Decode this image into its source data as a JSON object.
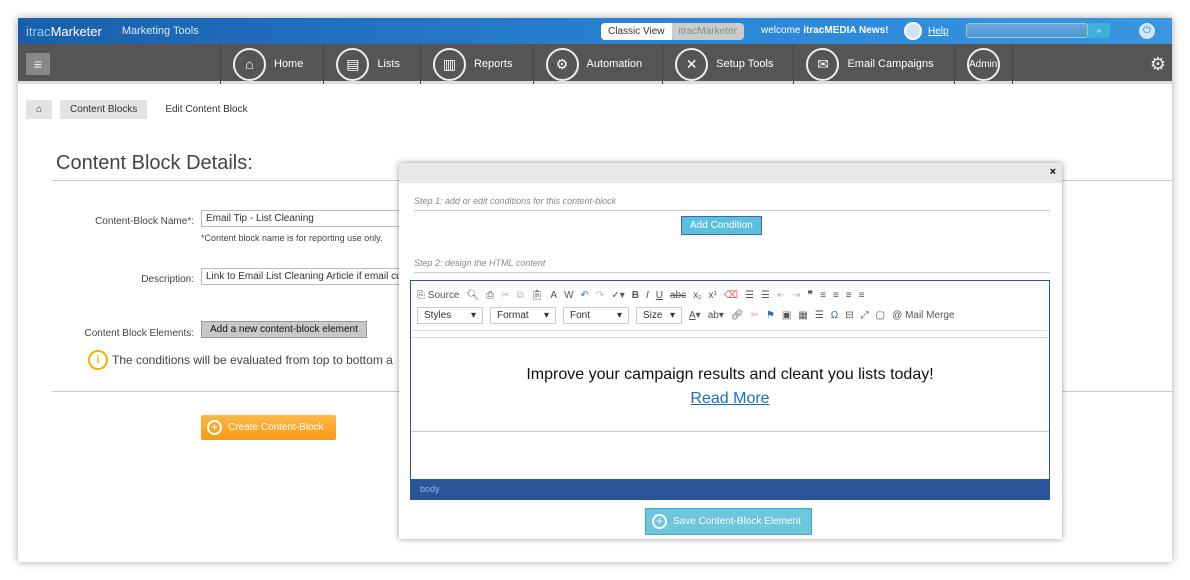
{
  "header": {
    "logo_prefix": "itrac",
    "logo_suffix": "Marketer",
    "subtitle": "Marketing Tools",
    "views": [
      "Classic View",
      "itracMarketer"
    ],
    "welcome": "welcome",
    "user": "itracMEDIA News!",
    "help": "Help",
    "search_placeholder": ""
  },
  "nav": {
    "items": [
      {
        "label": "Home",
        "icon": "home-icon",
        "glyph": "⌂"
      },
      {
        "label": "Lists",
        "icon": "contacts-icon",
        "glyph": "▤"
      },
      {
        "label": "Reports",
        "icon": "bar-chart-icon",
        "glyph": "▥"
      },
      {
        "label": "Automation",
        "icon": "gears-icon",
        "glyph": "⚙"
      },
      {
        "label": "Setup Tools",
        "icon": "tools-icon",
        "glyph": "✕"
      },
      {
        "label": "Email Campaigns",
        "icon": "envelope-icon",
        "glyph": "✉"
      }
    ],
    "admin": "Admin"
  },
  "breadcrumb": [
    "Content Blocks",
    "Edit Content Block"
  ],
  "form": {
    "title": "Content Block Details:",
    "name_label": "Content-Block Name*:",
    "name_value": "Email Tip - List Cleaning",
    "name_note": "*Content block name is for reporting use only.",
    "desc_label": "Description:",
    "desc_value": "Link to Email List Cleaning Article if email cu",
    "elements_label": "Content Block Elements:",
    "add_element": "Add a new content-block element",
    "info": "The conditions will be evaluated from top to bottom a",
    "create": "Create Content-Block"
  },
  "modal": {
    "close": "×",
    "step1": "Step 1: add or edit conditions for this content-block",
    "add_condition": "Add Condition",
    "step2": "Step 2: design the HTML content",
    "toolbar": {
      "source": "Source",
      "styles": "Styles",
      "format": "Format",
      "font": "Font",
      "size": "Size",
      "mail_merge": "Mail Merge"
    },
    "content_text": "Improve your campaign results and cleant you lists today!",
    "content_link": "Read More",
    "status": "body",
    "save": "Save Content-Block Element"
  },
  "colors": {
    "topbar": "#1a5ea8",
    "nav": "#555555",
    "orange": "#f79a12",
    "teal": "#5bc0de",
    "editor_blue": "#2a5599"
  }
}
